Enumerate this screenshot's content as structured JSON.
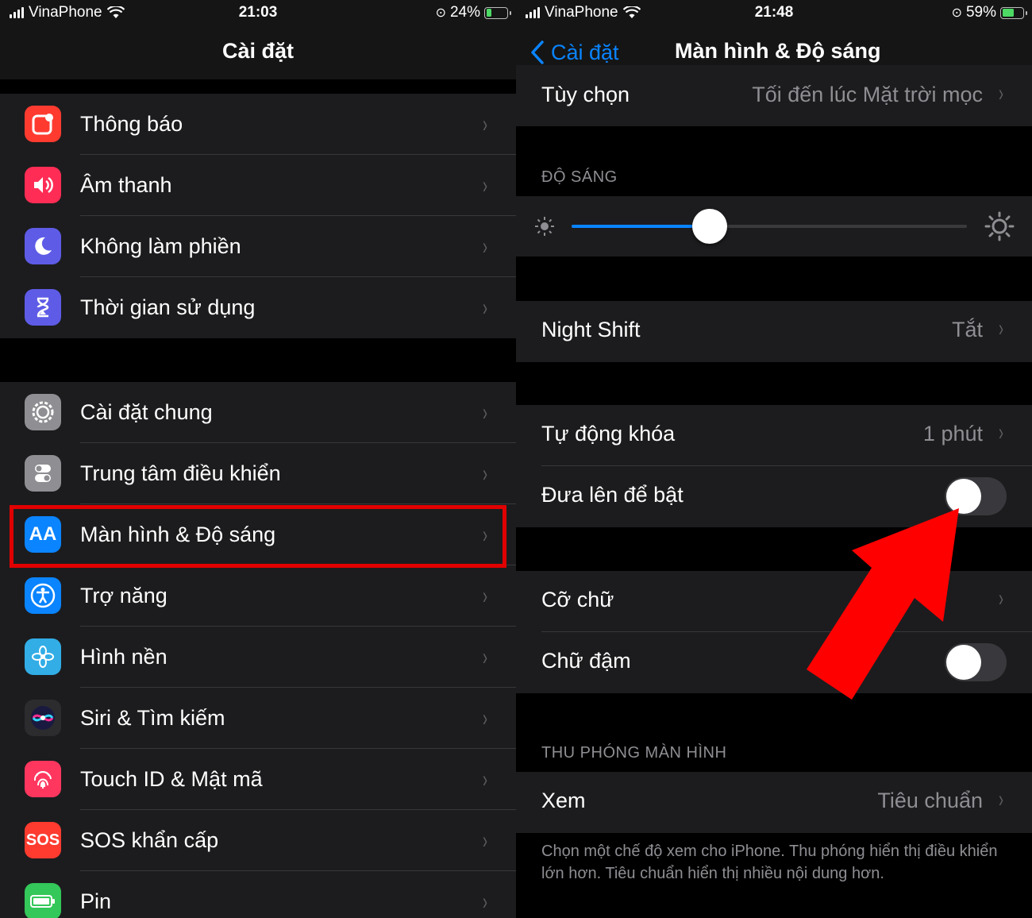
{
  "left": {
    "status": {
      "carrier": "VinaPhone",
      "time": "21:03",
      "battery": "24%",
      "battery_level": 0.24
    },
    "title": "Cài đặt",
    "group1": [
      {
        "label": "Thông báo",
        "icon": "notifications-icon",
        "color": "#ff3b30"
      },
      {
        "label": "Âm thanh",
        "icon": "sound-icon",
        "color": "#ff2d55"
      },
      {
        "label": "Không làm phiền",
        "icon": "moon-icon",
        "color": "#5e5ce6"
      },
      {
        "label": "Thời gian sử dụng",
        "icon": "hourglass-icon",
        "color": "#5e5ce6"
      }
    ],
    "group2": [
      {
        "label": "Cài đặt chung",
        "icon": "gear-icon",
        "color": "#8e8e93"
      },
      {
        "label": "Trung tâm điều khiển",
        "icon": "toggles-icon",
        "color": "#8e8e93"
      },
      {
        "label": "Màn hình & Độ sáng",
        "icon": "display-icon",
        "glyph": "AA",
        "color": "#0a84ff"
      },
      {
        "label": "Trợ năng",
        "icon": "accessibility-icon",
        "color": "#0a84ff"
      },
      {
        "label": "Hình nền",
        "icon": "wallpaper-icon",
        "color": "#32ade6"
      },
      {
        "label": "Siri & Tìm kiếm",
        "icon": "siri-icon",
        "color": "#2c2c2e"
      },
      {
        "label": "Touch ID & Mật mã",
        "icon": "fingerprint-icon",
        "color": "#ff375f"
      },
      {
        "label": "SOS khẩn cấp",
        "icon": "sos-icon",
        "glyph": "SOS",
        "color": "#ff3b30"
      },
      {
        "label": "Pin",
        "icon": "battery-icon",
        "color": "#34c759"
      }
    ]
  },
  "right": {
    "status": {
      "carrier": "VinaPhone",
      "time": "21:48",
      "battery": "59%",
      "battery_level": 0.59
    },
    "back_label": "Cài đặt",
    "title": "Màn hình & Độ sáng",
    "options": {
      "label": "Tùy chọn",
      "value": "Tối đến lúc Mặt trời mọc"
    },
    "brightness_header": "ĐỘ SÁNG",
    "brightness_level": 0.35,
    "night_shift": {
      "label": "Night Shift",
      "value": "Tắt"
    },
    "auto_lock": {
      "label": "Tự động khóa",
      "value": "1 phút"
    },
    "raise_to_wake": {
      "label": "Đưa lên để bật",
      "on": false
    },
    "text_size": {
      "label": "Cỡ chữ"
    },
    "bold_text": {
      "label": "Chữ đậm",
      "on": false
    },
    "zoom_header": "THU PHÓNG MÀN HÌNH",
    "view": {
      "label": "Xem",
      "value": "Tiêu chuẩn"
    },
    "zoom_note": "Chọn một chế độ xem cho iPhone. Thu phóng hiển thị điều khiển lớn hơn. Tiêu chuẩn hiển thị nhiều nội dung hơn."
  },
  "colors": {
    "highlight": "#e00000",
    "arrow": "#ff0000",
    "accent": "#0a84ff"
  }
}
